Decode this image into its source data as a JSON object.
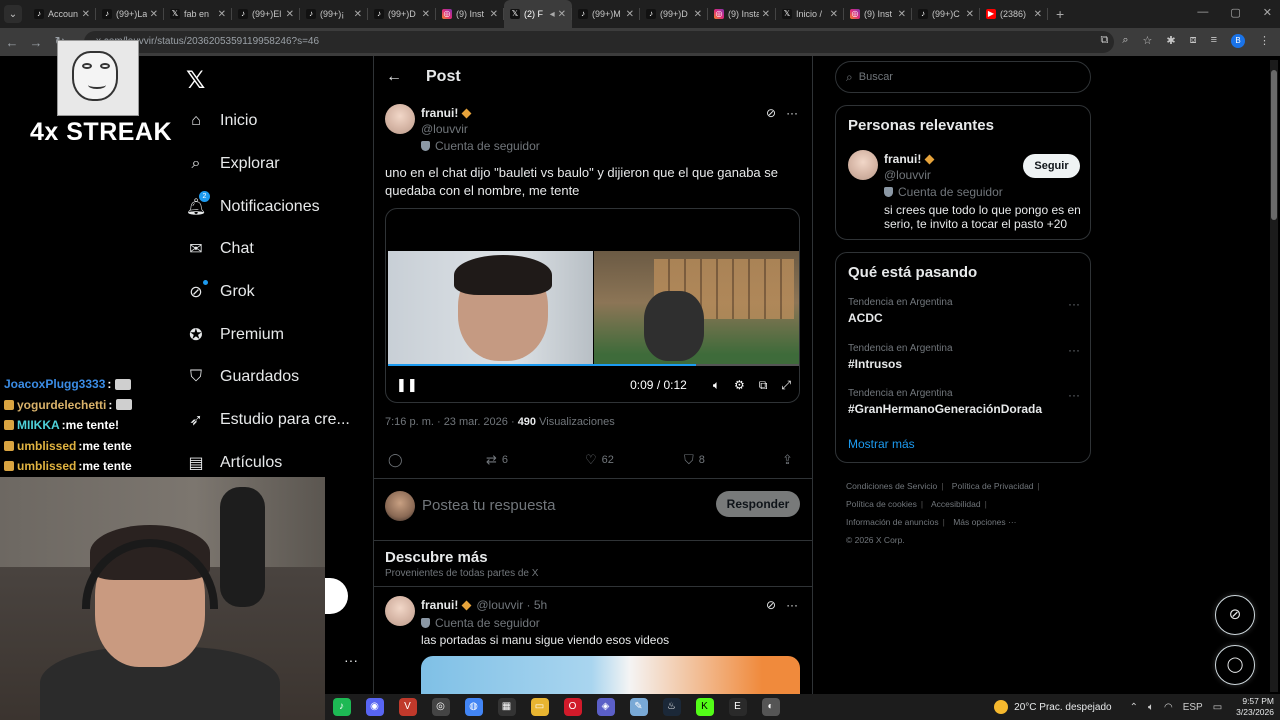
{
  "browser": {
    "tabs": [
      {
        "icon": "tiktok-icon",
        "label": "Accoun"
      },
      {
        "icon": "tiktok-icon",
        "label": "(99+)La"
      },
      {
        "icon": "x-icon",
        "label": "fab en"
      },
      {
        "icon": "tiktok-icon",
        "label": "(99+)El"
      },
      {
        "icon": "tiktok-icon",
        "label": "(99+)¡"
      },
      {
        "icon": "tiktok-icon",
        "label": "(99+)D"
      },
      {
        "icon": "instagram-icon",
        "label": "(9) Inst"
      },
      {
        "icon": "x-icon",
        "label": "(2) F",
        "active": true
      },
      {
        "icon": "tiktok-icon",
        "label": "(99+)M"
      },
      {
        "icon": "tiktok-icon",
        "label": "(99+)D"
      },
      {
        "icon": "instagram-icon",
        "label": "(9) Insta"
      },
      {
        "icon": "x-icon",
        "label": "Inicio /"
      },
      {
        "icon": "instagram-icon",
        "label": "(9) Inst"
      },
      {
        "icon": "tiktok-icon",
        "label": "(99+)C"
      },
      {
        "icon": "youtube-icon",
        "label": "(2386)"
      }
    ],
    "url": "x.com/louvvir/status/2036205359119958246?s=46"
  },
  "overlay": {
    "streak": "4x STREAK",
    "chat": [
      {
        "name": "JoacoxPlugg3333",
        "sep": " :",
        "message": "",
        "color": "#3b8de6",
        "emote": true
      },
      {
        "name": "yogurdelechetti",
        "sep": " :",
        "message": "",
        "color": "#d9b26a",
        "emote": true
      },
      {
        "name": "MIIKKA",
        "sep": " :",
        "message": " me tente!",
        "color": "#4fd1d9"
      },
      {
        "name": "umblissed",
        "sep": " :",
        "message": " me tente",
        "color": "#e0b341"
      },
      {
        "name": "umblissed",
        "sep": " :",
        "message": " me tente",
        "color": "#e0b341"
      }
    ]
  },
  "nav": {
    "items": [
      {
        "icon": "home-icon",
        "label": "Inicio"
      },
      {
        "icon": "search-icon",
        "label": "Explorar"
      },
      {
        "icon": "bell-icon",
        "label": "Notificaciones",
        "badge": "2"
      },
      {
        "icon": "mail-icon",
        "label": "Chat"
      },
      {
        "icon": "grok-icon",
        "label": "Grok"
      },
      {
        "icon": "verified-icon",
        "label": "Premium"
      },
      {
        "icon": "bookmark-icon",
        "label": "Guardados"
      },
      {
        "icon": "rocket-icon",
        "label": "Estudio para cre..."
      },
      {
        "icon": "article-icon",
        "label": "Artículos"
      }
    ]
  },
  "post": {
    "header": "Post",
    "author_name": "franui!",
    "author_handle": "@louvvir",
    "account_type": "Cuenta de seguidor",
    "text": "uno en el chat dijo \"bauleti vs baulo\" y dijieron que el que ganaba se quedaba con el nombre, me tente",
    "video": {
      "time": "0:09 / 0:12",
      "progress": 0.75
    },
    "timestamp": "7:16 p. m. · 23 mar. 2026 ·",
    "views": "490",
    "views_label": "Visualizaciones",
    "retweets": "6",
    "likes": "62",
    "bookmarks": "8"
  },
  "reply": {
    "placeholder": "Postea tu respuesta",
    "button": "Responder"
  },
  "discover": {
    "title": "Descubre más",
    "subtitle": "Provenientes de todas partes de X",
    "post": {
      "author_name": "franui!",
      "handle_time": "@louvvir · 5h",
      "account_type": "Cuenta de seguidor",
      "text": "las portadas si manu sigue viendo esos videos"
    }
  },
  "sidebar": {
    "search_placeholder": "Buscar",
    "relevant": {
      "title": "Personas relevantes",
      "name": "franui!",
      "handle": "@louvvir",
      "account_type": "Cuenta de seguidor",
      "bio": "si crees que todo lo que pongo es en serio, te invito a tocar el pasto +20",
      "follow": "Seguir"
    },
    "trends": {
      "title": "Qué está pasando",
      "items": [
        {
          "category": "Tendencia en Argentina",
          "name": "ACDC"
        },
        {
          "category": "Tendencia en Argentina",
          "name": "#Intrusos"
        },
        {
          "category": "Tendencia en Argentina",
          "name": "#GranHermanoGeneraciónDorada"
        }
      ],
      "show_more": "Mostrar más"
    },
    "footer": {
      "l1": "Condiciones de Servicio",
      "l2": "Política de Privacidad",
      "l3": "Política de cookies",
      "l4": "Accesibilidad",
      "l5": "Información de anuncios",
      "l6": "Más opciones ···",
      "copy": "© 2026 X Corp."
    }
  },
  "taskbar": {
    "weather": "20°C  Prac. despejado",
    "lang": "ESP",
    "time": "9:57 PM",
    "date": "3/23/2026"
  },
  "colors": {
    "accent": "#1d9bf0",
    "background": "#000000",
    "border": "#2f3336",
    "muted": "#71767b",
    "verified": "#e6a33b"
  }
}
